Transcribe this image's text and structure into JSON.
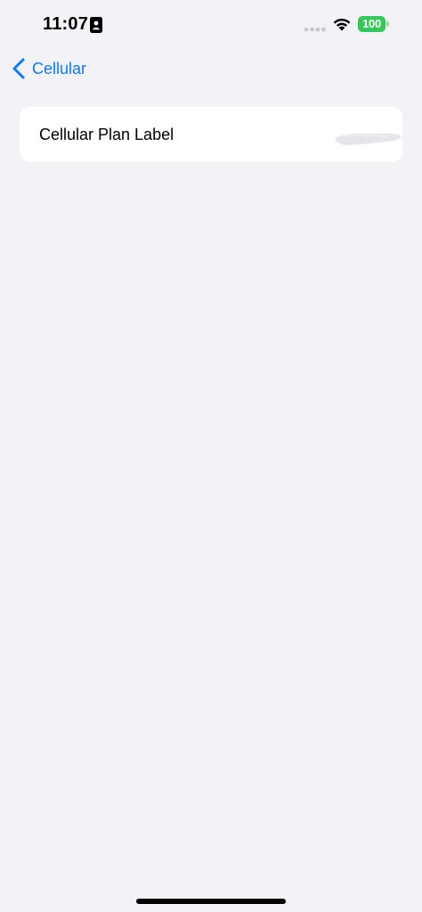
{
  "status_bar": {
    "time": "11:07",
    "battery_level": "100",
    "icons": [
      "contact-card-icon",
      "cellular-signal-icon",
      "wifi-icon",
      "battery-icon"
    ]
  },
  "nav": {
    "back_label": "Cellular",
    "back_icon": "chevron-left-icon"
  },
  "settings": {
    "rows": [
      {
        "label": "Cellular Plan Label",
        "value_redacted": true
      }
    ]
  },
  "colors": {
    "background": "#f2f2f7",
    "accent": "#0a7aff",
    "battery": "#34c759"
  }
}
